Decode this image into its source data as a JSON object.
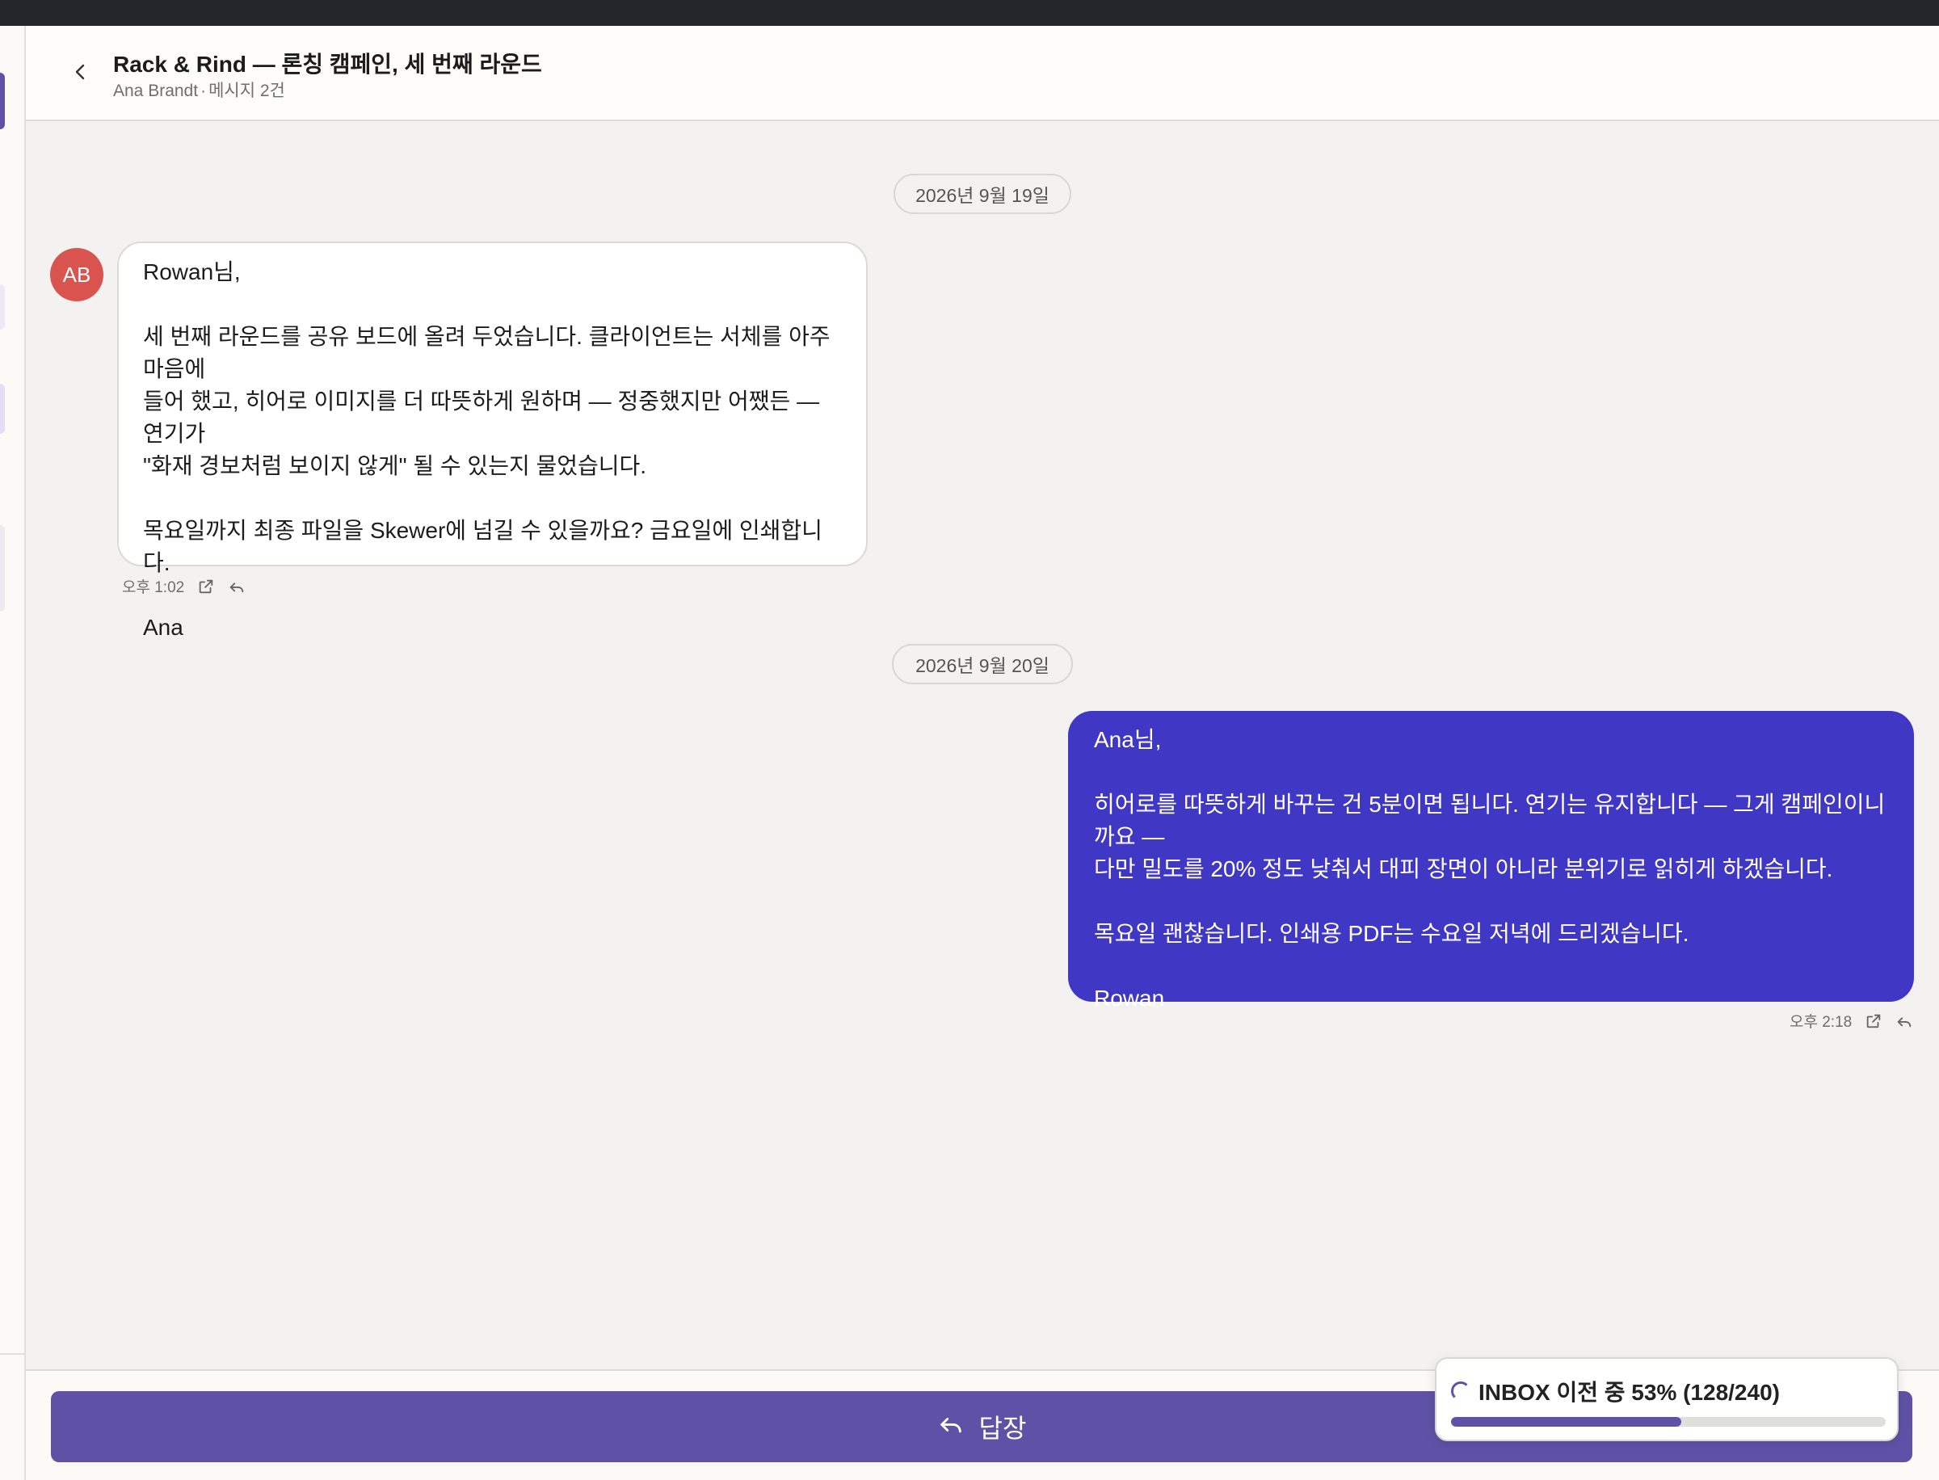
{
  "header": {
    "title": "Rack & Rind — 론칭 캠페인, 세 번째 라운드",
    "sender": "Ana Brandt",
    "separator": "·",
    "message_count": "메시지 2건"
  },
  "messages": [
    {
      "date": "2026년 9월 19일",
      "avatar_initials": "AB",
      "avatar_color": "#d9534f",
      "direction": "incoming",
      "lines": [
        "Rowan님,",
        "",
        "세 번째 라운드를 공유 보드에 올려 두었습니다. 클라이언트는 서체를 아주 마음에",
        "들어 했고, 히어로 이미지를 더 따뜻하게 원하며 — 정중했지만 어쨌든 — 연기가",
        "\"화재 경보처럼 보이지 않게\" 될 수 있는지 물었습니다.",
        "",
        "목요일까지 최종 파일을 Skewer에 넘길 수 있을까요? 금요일에 인쇄합니다.",
        "",
        "Ana"
      ],
      "time": "오후 1:02",
      "actions": [
        "open-external-icon",
        "reply-icon"
      ]
    },
    {
      "date": "2026년 9월 20일",
      "direction": "outgoing",
      "bubble_color": "#4038c4",
      "lines": [
        "Ana님,",
        "",
        "히어로를 따뜻하게 바꾸는 건 5분이면 됩니다. 연기는 유지합니다 — 그게 캠페인이니까요 —",
        "다만 밀도를 20% 정도 낮춰서 대피 장면이 아니라 분위기로 읽히게 하겠습니다.",
        "",
        "목요일 괜찮습니다. 인쇄용 PDF는 수요일 저녁에 드리겠습니다.",
        "",
        "Rowan"
      ],
      "time": "오후 2:18",
      "actions": [
        "open-external-icon",
        "reply-icon"
      ]
    }
  ],
  "reply": {
    "label": "답장",
    "button_color": "#5f52a6"
  },
  "migration": {
    "text": "INBOX 이전 중 53% (128/240)",
    "progress": 0.53,
    "done": 128,
    "total": 240
  },
  "colors": {
    "accent": "#5f52a6",
    "outgoing_bubble": "#4038c4",
    "avatar": "#d9534f"
  }
}
